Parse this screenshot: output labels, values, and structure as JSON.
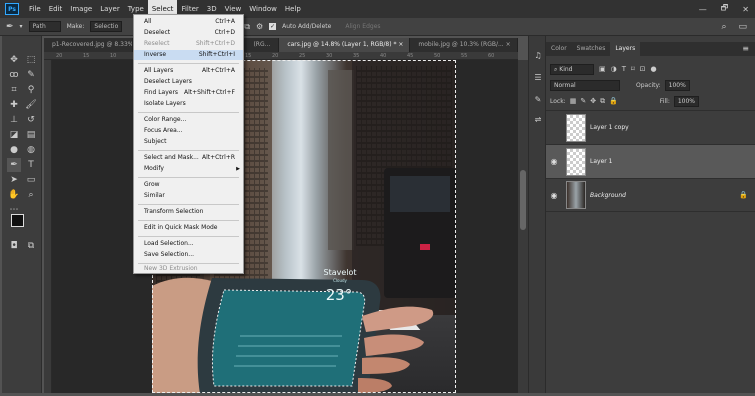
{
  "app": {
    "logo": "Ps"
  },
  "menubar": {
    "items": [
      "File",
      "Edit",
      "Image",
      "Layer",
      "Type",
      "Select",
      "Filter",
      "3D",
      "View",
      "Window",
      "Help"
    ],
    "active": "Select",
    "window_controls": [
      "—",
      "🗗",
      "✕"
    ]
  },
  "options_bar": {
    "path_label": "Path",
    "make_label": "Make:",
    "selection_label": "Selectio",
    "auto_add_delete": "Auto Add/Delete",
    "align_edges": "Align Edges"
  },
  "tabs": [
    {
      "label": "p1-Recovered.jpg @ 8.33% (RG..."
    },
    {
      "label": "(RG..."
    },
    {
      "label": "cars.jpg @ 14.8% (Layer 1, RGB/8) * ×"
    },
    {
      "label": "mobile.jpg @ 10.3% (RGB/... ×"
    }
  ],
  "ruler_ticks": [
    "20",
    "15",
    "10",
    "5",
    "0",
    "5",
    "10",
    "15",
    "20",
    "25",
    "30",
    "35",
    "40",
    "45",
    "50",
    "55",
    "60"
  ],
  "select_menu": {
    "items": [
      {
        "label": "All",
        "shortcut": "Ctrl+A",
        "dim": false
      },
      {
        "label": "Deselect",
        "shortcut": "Ctrl+D",
        "dim": false
      },
      {
        "label": "Reselect",
        "shortcut": "Shift+Ctrl+D",
        "dim": true
      },
      {
        "label": "Inverse",
        "shortcut": "Shift+Ctrl+I",
        "dim": false,
        "highlight": true
      },
      {
        "label": "All Layers",
        "shortcut": "Alt+Ctrl+A",
        "dim": false
      },
      {
        "label": "Deselect Layers",
        "shortcut": "",
        "dim": false
      },
      {
        "label": "Find Layers",
        "shortcut": "Alt+Shift+Ctrl+F",
        "dim": false
      },
      {
        "label": "Isolate Layers",
        "shortcut": "",
        "dim": false
      },
      {
        "label": "Color Range...",
        "shortcut": "",
        "dim": false
      },
      {
        "label": "Focus Area...",
        "shortcut": "",
        "dim": false
      },
      {
        "label": "Subject",
        "shortcut": "",
        "dim": false
      },
      {
        "label": "Select and Mask...",
        "shortcut": "Alt+Ctrl+R",
        "dim": false
      },
      {
        "label": "Modify",
        "shortcut": "",
        "dim": false,
        "submenu": true
      },
      {
        "label": "Grow",
        "shortcut": "",
        "dim": false
      },
      {
        "label": "Similar",
        "shortcut": "",
        "dim": false
      },
      {
        "label": "Transform Selection",
        "shortcut": "",
        "dim": false
      },
      {
        "label": "Edit in Quick Mask Mode",
        "shortcut": "",
        "dim": false
      },
      {
        "label": "Load Selection...",
        "shortcut": "",
        "dim": false
      },
      {
        "label": "Save Selection...",
        "shortcut": "",
        "dim": false
      },
      {
        "label": "New 3D Extrusion",
        "shortcut": "",
        "dim": true
      }
    ]
  },
  "phone_screen": {
    "city": "Stavelot",
    "subtitle": "Cloudy",
    "temp": "23°"
  },
  "panel": {
    "tabs": [
      "Color",
      "Swatches",
      "Layers"
    ],
    "active_tab": "Layers",
    "kind_label": "Kind",
    "blend_mode": "Normal",
    "opacity_label": "Opacity:",
    "opacity_value": "100%",
    "lock_label": "Lock:",
    "fill_label": "Fill:",
    "fill_value": "100%",
    "layers": [
      {
        "name": "Layer 1 copy",
        "visible": false,
        "selected": false,
        "italic": false
      },
      {
        "name": "Layer 1",
        "visible": true,
        "selected": true,
        "italic": false
      },
      {
        "name": "Background",
        "visible": true,
        "selected": false,
        "italic": true,
        "locked": true
      }
    ]
  },
  "colors": {
    "accent": "#31a8ff",
    "menu_highlight": "#c9dcf2",
    "selected_layer": "#595959"
  }
}
